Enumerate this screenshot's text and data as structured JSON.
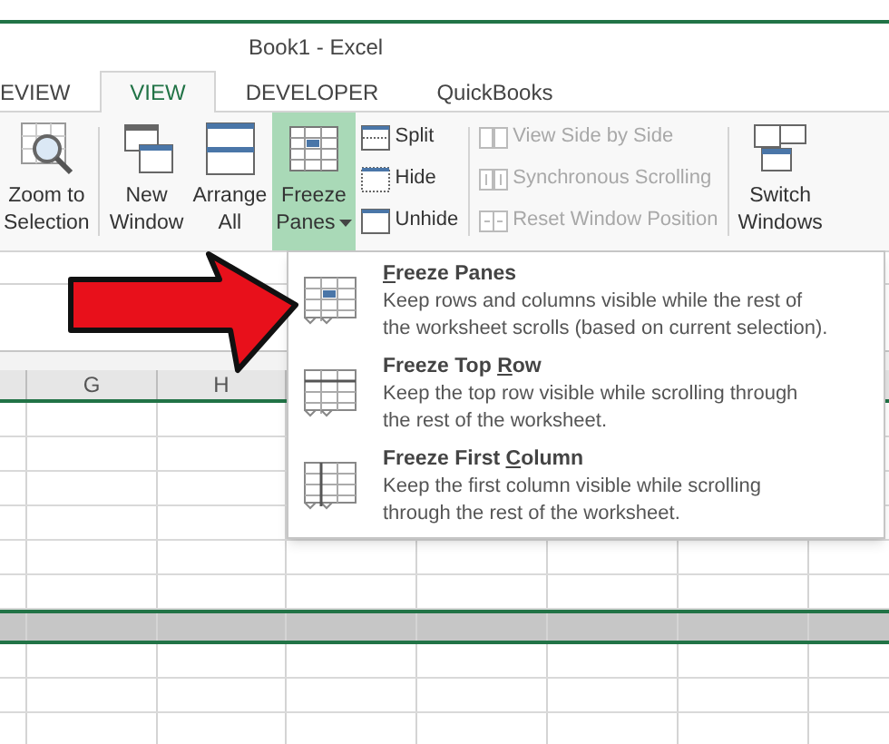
{
  "window": {
    "title": "Book1 - Excel"
  },
  "tabs": [
    {
      "label": "EVIEW",
      "selected": false
    },
    {
      "label": "VIEW",
      "selected": true
    },
    {
      "label": "DEVELOPER",
      "selected": false
    },
    {
      "label": "QuickBooks",
      "selected": false
    }
  ],
  "ribbon_items": [
    {
      "kind": "large",
      "lines": [
        "Zoom to",
        "Selection"
      ],
      "selected": false,
      "has_menu": false
    },
    {
      "kind": "separator"
    },
    {
      "kind": "large",
      "lines": [
        "New",
        "Window"
      ],
      "selected": false,
      "has_menu": false
    },
    {
      "kind": "large",
      "lines": [
        "Arrange",
        "All"
      ],
      "selected": false,
      "has_menu": false
    },
    {
      "kind": "large",
      "lines": [
        "Freeze",
        "Panes"
      ],
      "selected": true,
      "has_menu": true
    },
    {
      "kind": "stack",
      "buttons": [
        {
          "label": "Split",
          "disabled": false
        },
        {
          "label": "Hide",
          "disabled": false
        },
        {
          "label": "Unhide",
          "disabled": false
        }
      ]
    },
    {
      "kind": "separator"
    },
    {
      "kind": "stack",
      "buttons": [
        {
          "label": "View Side by Side",
          "disabled": true
        },
        {
          "label": "Synchronous Scrolling",
          "disabled": true
        },
        {
          "label": "Reset Window Position",
          "disabled": true
        }
      ]
    },
    {
      "kind": "separator"
    },
    {
      "kind": "large",
      "lines": [
        "Switch",
        "Windows"
      ],
      "selected": false,
      "has_menu": false
    }
  ],
  "sheet": {
    "columns": [
      {},
      {
        "label": "G"
      },
      {
        "label": "H"
      },
      {},
      {},
      {},
      {},
      {}
    ],
    "rows": [
      {
        "selected": false
      },
      {
        "selected": false
      },
      {
        "selected": false
      },
      {
        "selected": false
      },
      {
        "selected": false
      },
      {
        "selected": false
      },
      {
        "selected": true
      },
      {
        "selected": false
      },
      {
        "selected": false
      },
      {
        "selected": false
      }
    ]
  },
  "menu": {
    "items": [
      {
        "access_key": "F",
        "title_after": "reeze Panes",
        "description_lines": [
          "Keep rows and columns visible while the rest of",
          "the worksheet scrolls (based on current selection)."
        ]
      },
      {
        "title_before": "Freeze Top ",
        "access_key": "R",
        "title_after": "ow",
        "description_lines": [
          "Keep the top row visible while scrolling through",
          "the rest of the worksheet."
        ]
      },
      {
        "title_before": "Freeze First ",
        "access_key": "C",
        "title_after": "olumn",
        "description_lines": [
          "Keep the first column visible while scrolling",
          "through the rest of the worksheet."
        ]
      }
    ]
  }
}
